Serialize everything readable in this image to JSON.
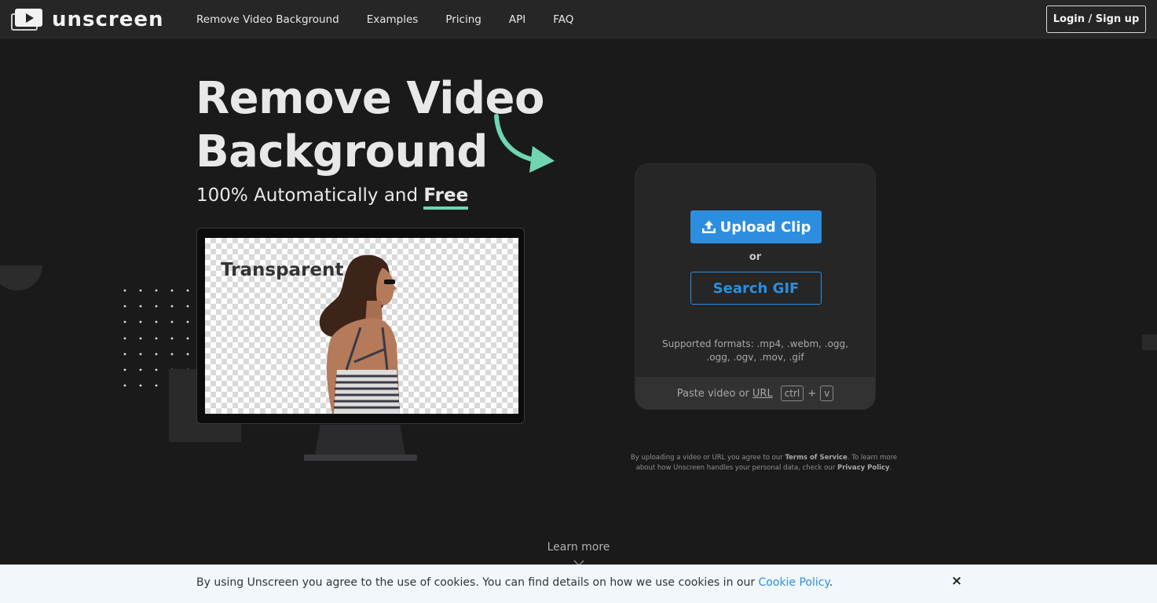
{
  "brand": {
    "name": "unscreen"
  },
  "nav": {
    "items": [
      {
        "label": "Remove Video Background"
      },
      {
        "label": "Examples"
      },
      {
        "label": "Pricing"
      },
      {
        "label": "API"
      },
      {
        "label": "FAQ"
      }
    ],
    "login_label": "Login / Sign up"
  },
  "hero": {
    "title_line1": "Remove Video",
    "title_line2": "Background",
    "subtitle_prefix": "100% Automatically and ",
    "subtitle_emphasis": "Free",
    "demo_label": "Transparent"
  },
  "upload": {
    "upload_label": "Upload Clip",
    "or_label": "or",
    "search_label": "Search GIF",
    "formats_text": "Supported formats: .mp4, .webm, .ogg, .ogg, .ogv, .mov, .gif",
    "paste_prefix": "Paste video or ",
    "paste_url_label": "URL",
    "key_ctrl": "ctrl",
    "key_plus": "+",
    "key_v": "v"
  },
  "terms": {
    "prefix": "By uploading a video or URL you agree to our ",
    "tos_label": "Terms of Service",
    "middle": ". To learn more about how Unscreen handles your personal data, check our ",
    "privacy_label": "Privacy Policy",
    "suffix": "."
  },
  "learn_more": {
    "label": "Learn more"
  },
  "cookie": {
    "text": "By using Unscreen you agree to the use of cookies. You can find details on how we use cookies in our ",
    "link_label": "Cookie Policy",
    "suffix": ".",
    "close_label": "×"
  },
  "colors": {
    "background": "#1a1a1a",
    "header": "#262626",
    "accent_blue": "#2d8ee0",
    "accent_green": "#6fd6b0",
    "cookie_bar": "#f1f7fa"
  },
  "icons": {
    "logo": "play-screen-icon",
    "upload": "upload-icon",
    "arrow": "curved-arrow-icon",
    "chevron": "chevron-down-icon",
    "close": "close-icon"
  }
}
